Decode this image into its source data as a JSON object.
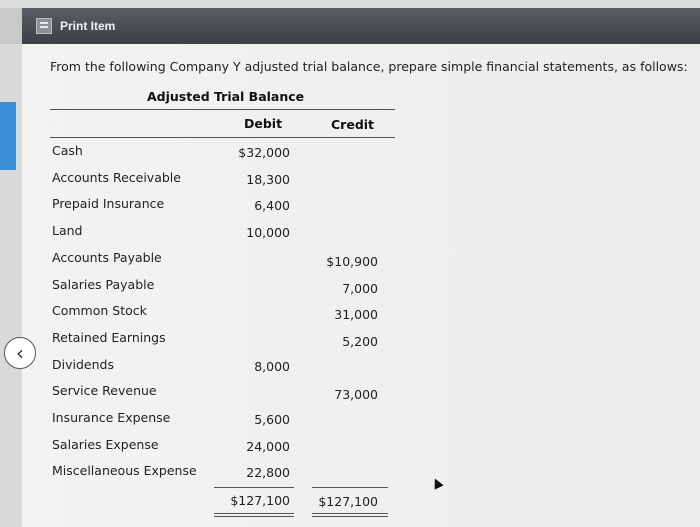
{
  "window": {
    "title": "Print Item"
  },
  "instruction": "From the following Company Y adjusted trial balance, prepare simple financial statements, as follows:",
  "table": {
    "title": "Adjusted Trial Balance",
    "headers": {
      "debit": "Debit",
      "credit": "Credit"
    },
    "rows": [
      {
        "account": "Cash",
        "debit": "$32,000",
        "credit": ""
      },
      {
        "account": "Accounts Receivable",
        "debit": "18,300",
        "credit": ""
      },
      {
        "account": "Prepaid Insurance",
        "debit": "6,400",
        "credit": ""
      },
      {
        "account": "Land",
        "debit": "10,000",
        "credit": ""
      },
      {
        "account": "Accounts Payable",
        "debit": "",
        "credit": "$10,900"
      },
      {
        "account": "Salaries Payable",
        "debit": "",
        "credit": "7,000"
      },
      {
        "account": "Common Stock",
        "debit": "",
        "credit": "31,000"
      },
      {
        "account": "Retained Earnings",
        "debit": "",
        "credit": "5,200"
      },
      {
        "account": "Dividends",
        "debit": "8,000",
        "credit": ""
      },
      {
        "account": "Service Revenue",
        "debit": "",
        "credit": "73,000"
      },
      {
        "account": "Insurance Expense",
        "debit": "5,600",
        "credit": ""
      },
      {
        "account": "Salaries Expense",
        "debit": "24,000",
        "credit": ""
      },
      {
        "account": "Miscellaneous Expense",
        "debit": "22,800",
        "credit": ""
      }
    ],
    "totals": {
      "debit": "$127,100",
      "credit": "$127,100"
    }
  },
  "icons": {
    "title": "document-icon",
    "back": "chevron-left-icon"
  },
  "colors": {
    "titlebar": "#45484d",
    "accent_tab": "#3b8fd6"
  }
}
